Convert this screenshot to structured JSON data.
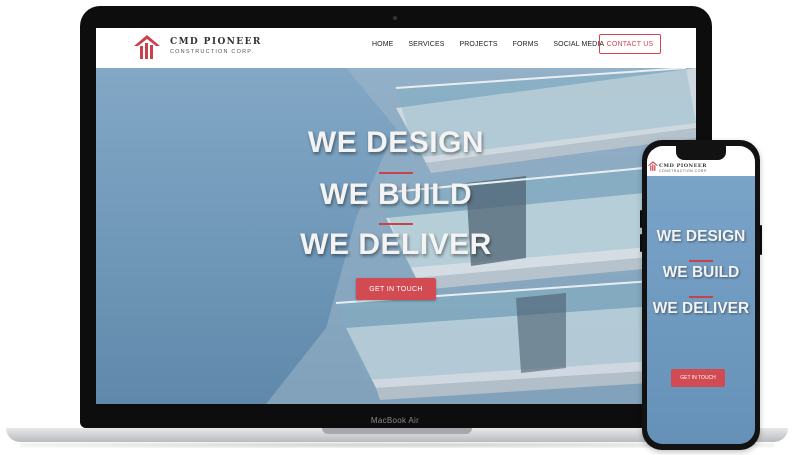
{
  "site": {
    "logo_title": "CMD PIONEER",
    "logo_subtitle": "CONSTRUCTION CORP.",
    "nav": [
      "HOME",
      "SERVICES",
      "PROJECTS",
      "FORMS",
      "SOCIAL MEDIA"
    ],
    "contact_button": "CONTACT US"
  },
  "hero": {
    "line1": "WE DESIGN",
    "line2": "WE BUILD",
    "line3": "WE DELIVER",
    "cta": "GET IN TOUCH"
  },
  "device": {
    "laptop_brand": "MacBook Air"
  },
  "mobile": {
    "logo_title": "CMD PIONEER",
    "logo_subtitle": "CONSTRUCTION CORP.",
    "line1": "WE DESIGN",
    "line2": "WE BUILD",
    "line3": "WE DELIVER",
    "cta": "GET IN TOUCH"
  },
  "colors": {
    "accent": "#d6454f",
    "hero_sky": "#6f97b8"
  }
}
